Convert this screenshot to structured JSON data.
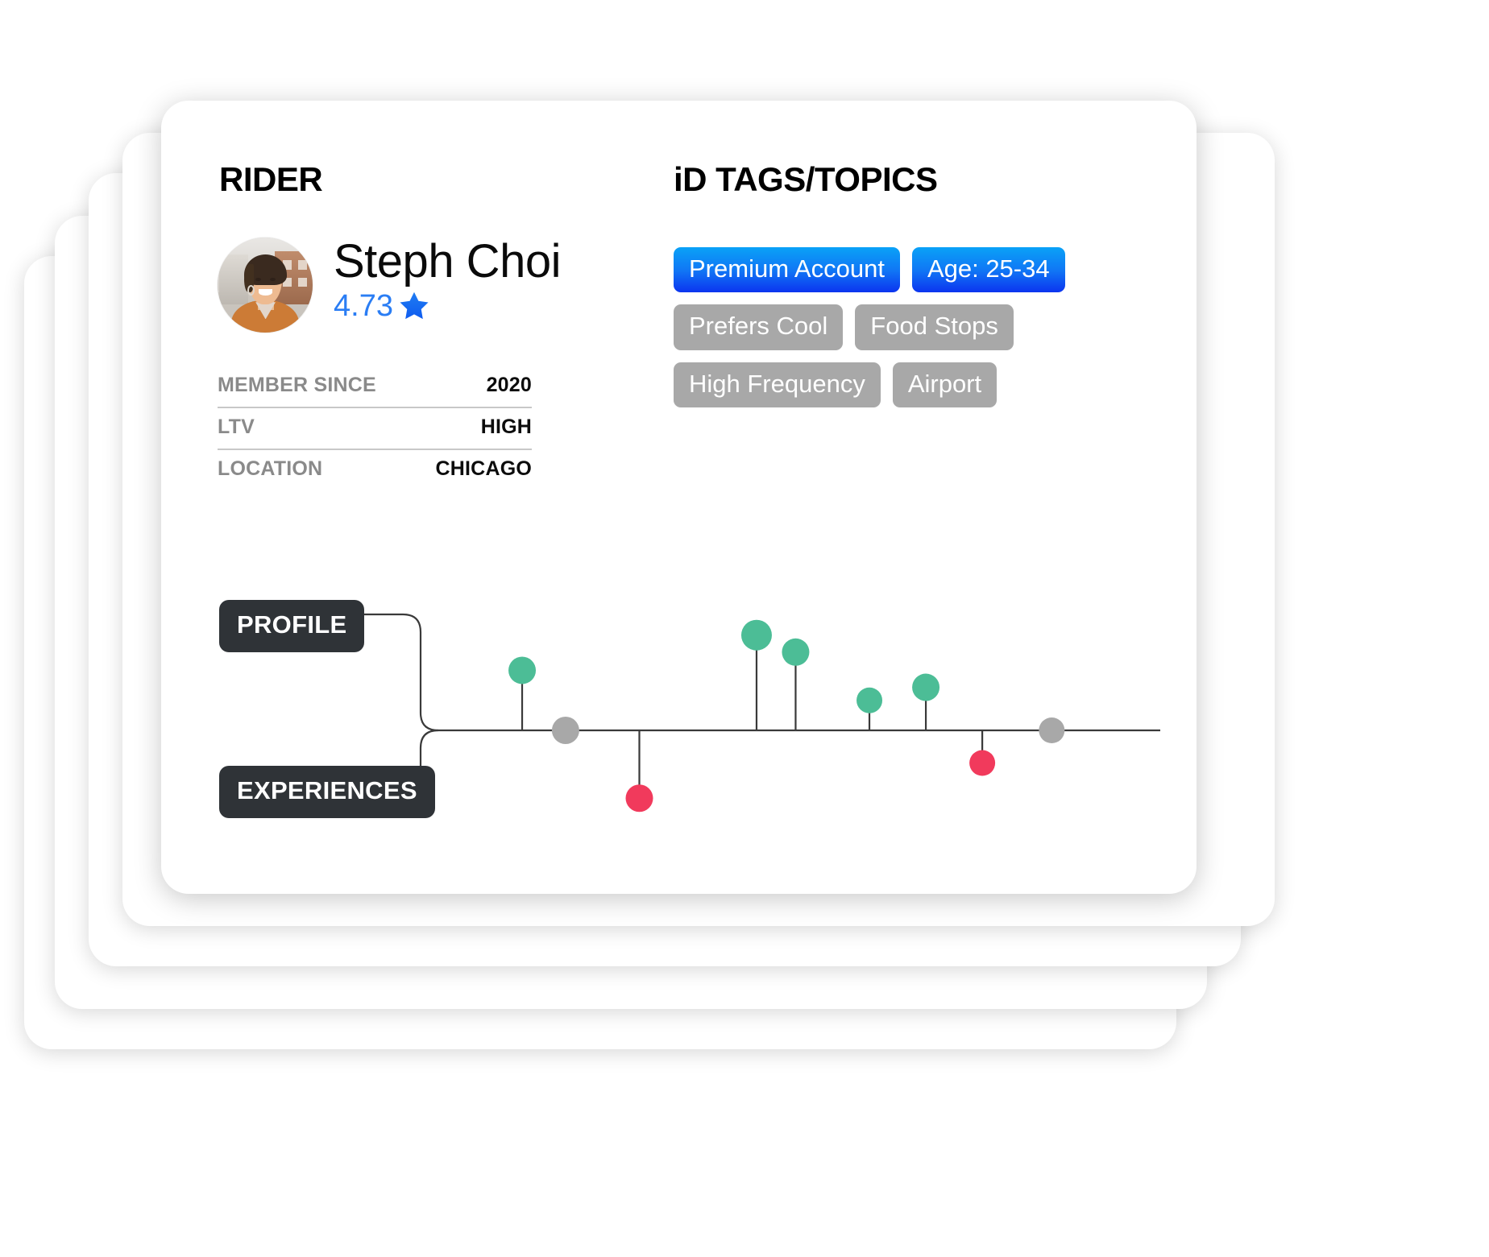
{
  "card": {
    "sections": {
      "rider_heading": "RIDER",
      "tags_heading": "iD TAGS/TOPICS"
    },
    "profile": {
      "name": "Steph Choi",
      "rating": "4.73",
      "star_icon": "star-icon",
      "avatar_alt": "rider-avatar",
      "rating_color": "#2a7df4"
    },
    "attributes": [
      {
        "label": "MEMBER SINCE",
        "value": "2020"
      },
      {
        "label": "LTV",
        "value": "HIGH"
      },
      {
        "label": "LOCATION",
        "value": "CHICAGO"
      }
    ],
    "tags": [
      {
        "label": "Premium Account",
        "style": "blue"
      },
      {
        "label": "Age: 25-34",
        "style": "blue"
      },
      {
        "label": "Prefers Cool",
        "style": "grey"
      },
      {
        "label": "Food Stops",
        "style": "grey"
      },
      {
        "label": "High Frequency",
        "style": "grey"
      },
      {
        "label": "Airport",
        "style": "grey"
      }
    ],
    "timeline": {
      "labels": {
        "profile": "PROFILE",
        "experiences": "EXPERIENCES"
      },
      "colors": {
        "positive": "#4cbd96",
        "neutral": "#a8a8a8",
        "negative": "#f13a5c",
        "axis": "#3a3a3a"
      }
    }
  },
  "chart_data": {
    "type": "scatter",
    "title": "",
    "xlabel": "",
    "ylabel": "",
    "description": "Stem/lollipop event timeline along a horizontal axis. Positive (green) events rise above the axis, negative (red) events drop below, neutral (grey) sit on the axis.",
    "axis": {
      "y_baseline": 0,
      "x_range": [
        0,
        100
      ],
      "grid": false,
      "legend": false
    },
    "points": [
      {
        "x": 26.5,
        "y": 46,
        "color": "positive",
        "radius": 17
      },
      {
        "x": 31.5,
        "y": 0,
        "color": "neutral",
        "radius": 17
      },
      {
        "x": 40.0,
        "y": -52,
        "color": "negative",
        "radius": 17
      },
      {
        "x": 53.5,
        "y": 73,
        "color": "positive",
        "radius": 19
      },
      {
        "x": 58.0,
        "y": 60,
        "color": "positive",
        "radius": 17
      },
      {
        "x": 66.5,
        "y": 23,
        "color": "positive",
        "radius": 16
      },
      {
        "x": 73.0,
        "y": 33,
        "color": "positive",
        "radius": 17
      },
      {
        "x": 79.5,
        "y": -25,
        "color": "negative",
        "radius": 16
      },
      {
        "x": 87.5,
        "y": 0,
        "color": "neutral",
        "radius": 16
      }
    ]
  }
}
